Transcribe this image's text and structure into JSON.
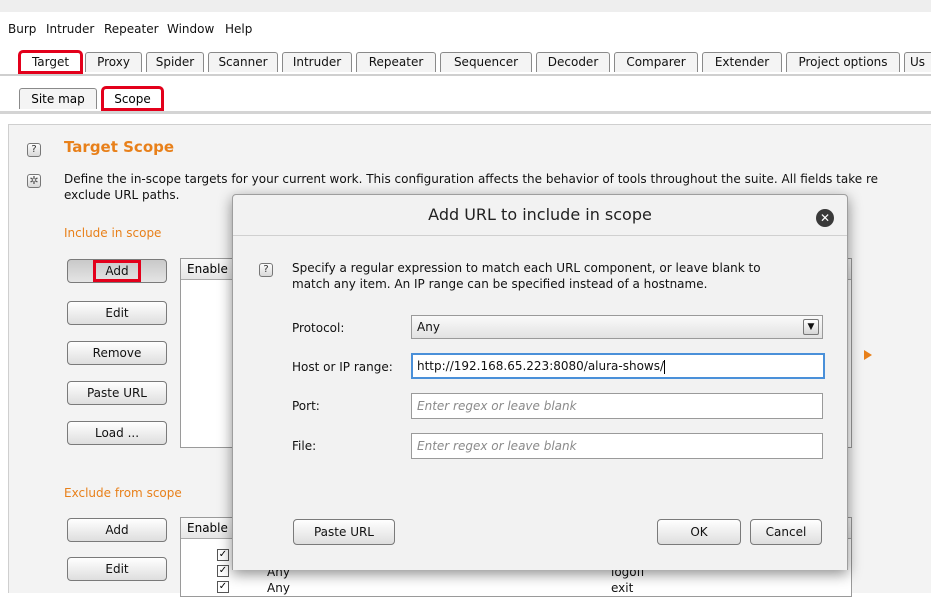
{
  "menu": [
    "Burp",
    "Intruder",
    "Repeater",
    "Window",
    "Help"
  ],
  "tabs": [
    "Target",
    "Proxy",
    "Spider",
    "Scanner",
    "Intruder",
    "Repeater",
    "Sequencer",
    "Decoder",
    "Comparer",
    "Extender",
    "Project options",
    "Us"
  ],
  "subtabs": [
    "Site map",
    "Scope"
  ],
  "panel": {
    "title": "Target Scope",
    "description_line1": "Define the in-scope targets for your current work. This configuration affects the behavior of tools throughout the suite. All fields take re",
    "description_line2": "exclude URL paths.",
    "include_title": "Include in scope",
    "exclude_title": "Exclude from scope",
    "include_buttons": [
      "Add",
      "Edit",
      "Remove",
      "Paste URL",
      "Load ..."
    ],
    "exclude_buttons": [
      "Add",
      "Edit"
    ],
    "table_header": "Enable",
    "exclude_rows": [
      {
        "col2": "",
        "col3": ""
      },
      {
        "col2": "Any",
        "col3": "logoff"
      },
      {
        "col2": "Any",
        "col3": "exit"
      }
    ]
  },
  "dialog": {
    "title": "Add URL to include in scope",
    "instructions_line1": "Specify a regular expression to match each URL component, or leave blank to",
    "instructions_line2": "match any item. An IP range can be specified instead of a hostname.",
    "protocol_label": "Protocol:",
    "protocol_value": "Any",
    "host_label": "Host or IP range:",
    "host_value": "http://192.168.65.223:8080/alura-shows/",
    "port_label": "Port:",
    "port_placeholder": "Enter regex or leave blank",
    "file_label": "File:",
    "file_placeholder": "Enter regex or leave blank",
    "paste_url": "Paste URL",
    "ok": "OK",
    "cancel": "Cancel"
  },
  "colors": {
    "accent": "#e8801a",
    "highlight": "#e3001b",
    "focus": "#4a90d9"
  }
}
